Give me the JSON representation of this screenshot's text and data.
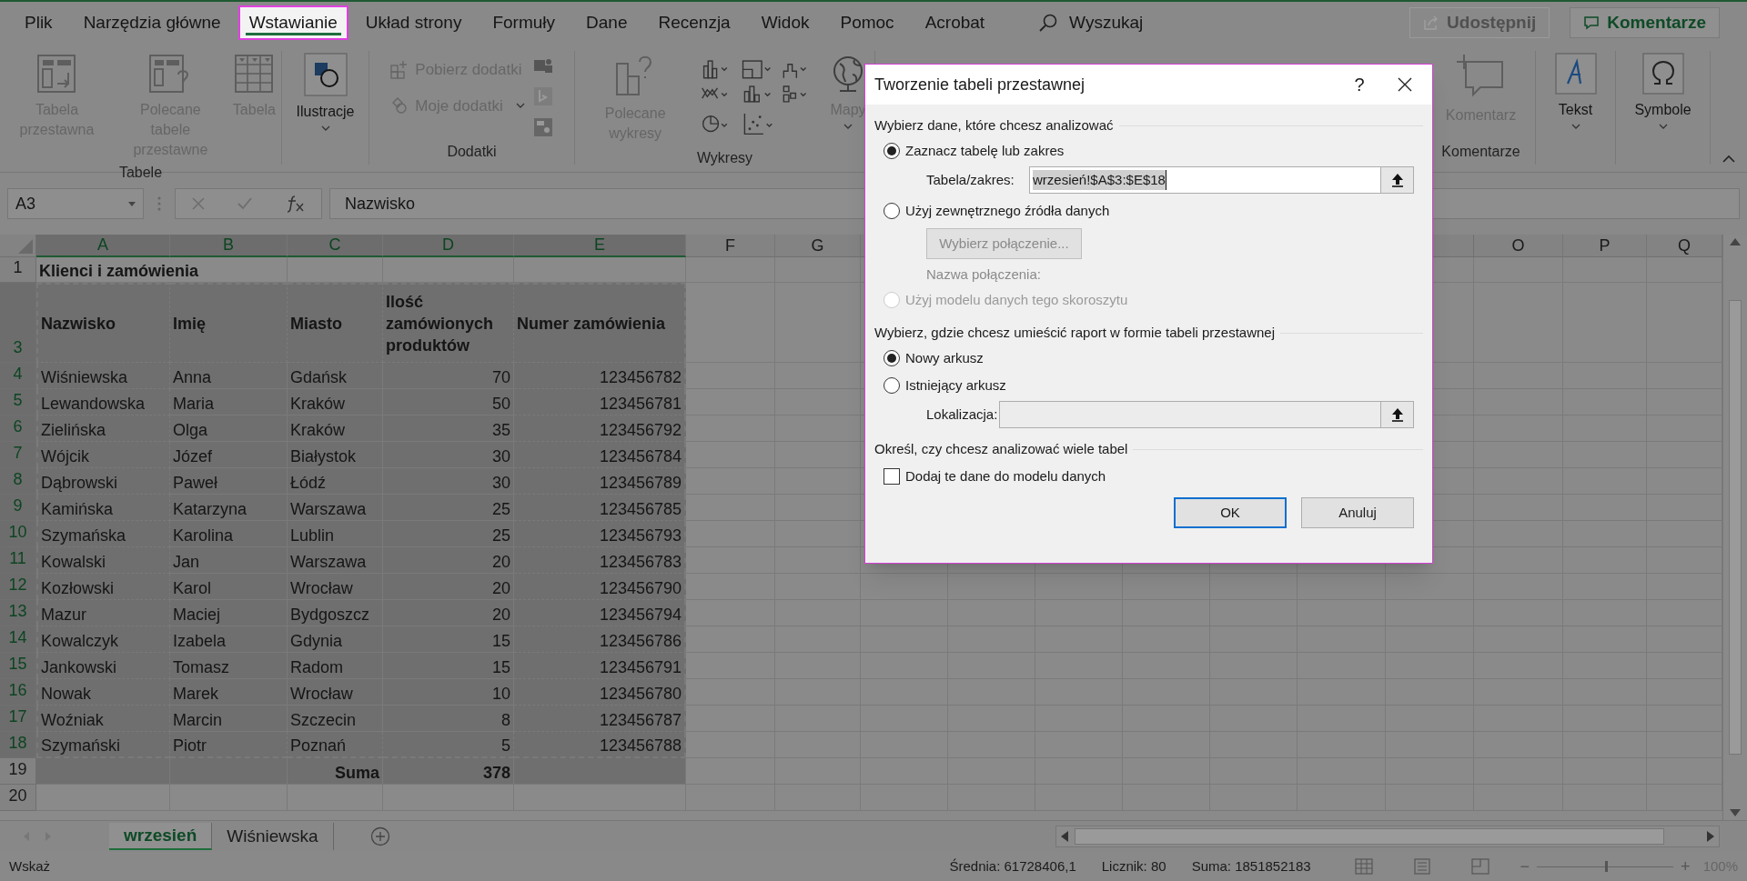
{
  "menu_tabs": [
    {
      "label": "Plik",
      "selected": false
    },
    {
      "label": "Narzędzia główne",
      "selected": false
    },
    {
      "label": "Wstawianie",
      "selected": true
    },
    {
      "label": "Układ strony",
      "selected": false
    },
    {
      "label": "Formuły",
      "selected": false
    },
    {
      "label": "Dane",
      "selected": false
    },
    {
      "label": "Recenzja",
      "selected": false
    },
    {
      "label": "Widok",
      "selected": false
    },
    {
      "label": "Pomoc",
      "selected": false
    },
    {
      "label": "Acrobat",
      "selected": false
    }
  ],
  "search": {
    "label": "Wyszukaj"
  },
  "share_button": {
    "label": "Udostępnij",
    "disabled": true
  },
  "comments_button": {
    "label": "Komentarze"
  },
  "ribbon": {
    "left_groups": [
      {
        "label": "Tabele",
        "items": [
          {
            "kind": "large",
            "label": "Tabela przestawna",
            "disabled": true,
            "dropdown": false
          },
          {
            "kind": "large",
            "label": "Polecane tabele przestawne",
            "disabled": true,
            "dropdown": false
          },
          {
            "kind": "large",
            "label": "Tabela",
            "disabled": true,
            "dropdown": false
          }
        ]
      },
      {
        "items": [
          {
            "kind": "large",
            "label": "Ilustracje",
            "disabled": false,
            "dropdown": true
          }
        ]
      },
      {
        "label": "Dodatki",
        "items": [
          {
            "kind": "small",
            "entries": [
              {
                "label": "Pobierz dodatki",
                "dropdown": false
              },
              {
                "label": "Moje dodatki",
                "dropdown": true
              }
            ]
          },
          {
            "kind": "icons"
          }
        ]
      },
      {
        "label": "Wykresy",
        "items": [
          {
            "kind": "large",
            "label": "Polecane wykresy",
            "disabled": true,
            "dropdown": false
          },
          {
            "kind": "gallery"
          },
          {
            "kind": "large",
            "label": "Mapy",
            "disabled": true,
            "dropdown": true
          }
        ]
      }
    ],
    "right_groups": [
      {
        "label": "Komentarze",
        "items": [
          {
            "kind": "large",
            "label": "Komentarz",
            "disabled": true,
            "dropdown": false
          }
        ]
      },
      {
        "items": [
          {
            "kind": "large",
            "label": "Tekst",
            "disabled": false,
            "dropdown": true
          }
        ]
      },
      {
        "items": [
          {
            "kind": "large",
            "label": "Symbole",
            "disabled": false,
            "dropdown": true
          }
        ]
      }
    ]
  },
  "formula_bar": {
    "name_box": "A3",
    "formula": "Nazwisko"
  },
  "columns": [
    {
      "label": "A",
      "selected": true
    },
    {
      "label": "B",
      "selected": true
    },
    {
      "label": "C",
      "selected": true
    },
    {
      "label": "D",
      "selected": true
    },
    {
      "label": "E",
      "selected": true
    },
    {
      "label": "F",
      "selected": false
    },
    {
      "label": "G",
      "selected": false
    },
    {
      "label": "O",
      "selected": false
    },
    {
      "label": "P",
      "selected": false
    },
    {
      "label": "Q",
      "selected": false
    }
  ],
  "rows": [
    {
      "number": "1",
      "kind": "title",
      "selected": false,
      "cells": [
        "Klienci i zamówienia"
      ]
    },
    {
      "number": "3",
      "kind": "header",
      "selected": true,
      "cells": [
        "Nazwisko",
        "Imię",
        "Miasto",
        "Ilość zamówionych produktów",
        "Numer zamówienia"
      ]
    },
    {
      "number": "4",
      "kind": "data",
      "selected": true,
      "cells": [
        "Wiśniewska",
        "Anna",
        "Gdańsk",
        "70",
        "123456782"
      ]
    },
    {
      "number": "5",
      "kind": "data",
      "selected": true,
      "cells": [
        "Lewandowska",
        "Maria",
        "Kraków",
        "50",
        "123456781"
      ]
    },
    {
      "number": "6",
      "kind": "data",
      "selected": true,
      "cells": [
        "Zielińska",
        "Olga",
        "Kraków",
        "35",
        "123456792"
      ]
    },
    {
      "number": "7",
      "kind": "data",
      "selected": true,
      "cells": [
        "Wójcik",
        "Józef",
        "Białystok",
        "30",
        "123456784"
      ]
    },
    {
      "number": "8",
      "kind": "data",
      "selected": true,
      "cells": [
        "Dąbrowski",
        "Paweł",
        "Łódź",
        "30",
        "123456789"
      ]
    },
    {
      "number": "9",
      "kind": "data",
      "selected": true,
      "cells": [
        "Kamińska",
        "Katarzyna",
        "Warszawa",
        "25",
        "123456785"
      ]
    },
    {
      "number": "10",
      "kind": "data",
      "selected": true,
      "cells": [
        "Szymańska",
        "Karolina",
        "Lublin",
        "25",
        "123456793"
      ]
    },
    {
      "number": "11",
      "kind": "data",
      "selected": true,
      "cells": [
        "Kowalski",
        "Jan",
        "Warszawa",
        "20",
        "123456783"
      ]
    },
    {
      "number": "12",
      "kind": "data",
      "selected": true,
      "cells": [
        "Kozłowski",
        "Karol",
        "Wrocław",
        "20",
        "123456790"
      ]
    },
    {
      "number": "13",
      "kind": "data",
      "selected": true,
      "cells": [
        "Mazur",
        "Maciej",
        "Bydgoszcz",
        "20",
        "123456794"
      ]
    },
    {
      "number": "14",
      "kind": "data",
      "selected": true,
      "cells": [
        "Kowalczyk",
        "Izabela",
        "Gdynia",
        "15",
        "123456786"
      ]
    },
    {
      "number": "15",
      "kind": "data",
      "selected": true,
      "cells": [
        "Jankowski",
        "Tomasz",
        "Radom",
        "15",
        "123456791"
      ]
    },
    {
      "number": "16",
      "kind": "data",
      "selected": true,
      "cells": [
        "Nowak",
        "Marek",
        "Wrocław",
        "10",
        "123456780"
      ]
    },
    {
      "number": "17",
      "kind": "data",
      "selected": true,
      "cells": [
        "Woźniak",
        "Marcin",
        "Szczecin",
        "8",
        "123456787"
      ]
    },
    {
      "number": "18",
      "kind": "data",
      "selected": true,
      "cells": [
        "Szymański",
        "Piotr",
        "Poznań",
        "5",
        "123456788"
      ]
    },
    {
      "number": "19",
      "kind": "total",
      "selected": false,
      "label": "Suma",
      "value": "378"
    },
    {
      "number": "20",
      "kind": "empty",
      "selected": false
    }
  ],
  "sheet_tabs": [
    {
      "label": "wrzesień",
      "selected": true
    },
    {
      "label": "Wiśniewska",
      "selected": false
    }
  ],
  "status_bar": {
    "mode": "Wskaż",
    "stats": [
      "Średnia: 61728406,1",
      "Licznik: 80",
      "Suma: 1851852183"
    ],
    "zoom": "100%",
    "zoom_out": "−",
    "zoom_in": "+",
    "zoom_level": {
      "level": 0.5
    }
  },
  "dialog": {
    "title": "Tworzenie tabeli przestawnej",
    "help": "?",
    "source_heading": "Wybierz dane, które chcesz analizować",
    "source_options": [
      {
        "label": "Zaznacz tabelę lub zakres",
        "selected": true,
        "disabled": false
      },
      {
        "label": "Użyj zewnętrznego źródła danych",
        "selected": false,
        "disabled": false
      },
      {
        "label": "Użyj modelu danych tego skoroszytu",
        "selected": false,
        "disabled": true
      }
    ],
    "range_field": {
      "label": "Tabela/zakres:",
      "value": "wrzesień!$A$3:$E$18"
    },
    "connection_button": {
      "label": "Wybierz połączenie...",
      "disabled": true
    },
    "connection_name_label": "Nazwa połączenia:",
    "destination_heading": "Wybierz, gdzie chcesz umieścić raport w formie tabeli przestawnej",
    "destination_options": [
      {
        "label": "Nowy arkusz",
        "selected": true
      },
      {
        "label": "Istniejący arkusz",
        "selected": false
      }
    ],
    "location_field": {
      "label": "Lokalizacja:",
      "disabled": true
    },
    "multiple_heading": "Określ, czy chcesz analizować wiele tabel",
    "add_to_model": {
      "label": "Dodaj te dane do modelu danych",
      "checked": false
    },
    "buttons": [
      {
        "label": "OK",
        "default": true
      },
      {
        "label": "Anuluj",
        "default": false
      }
    ]
  }
}
